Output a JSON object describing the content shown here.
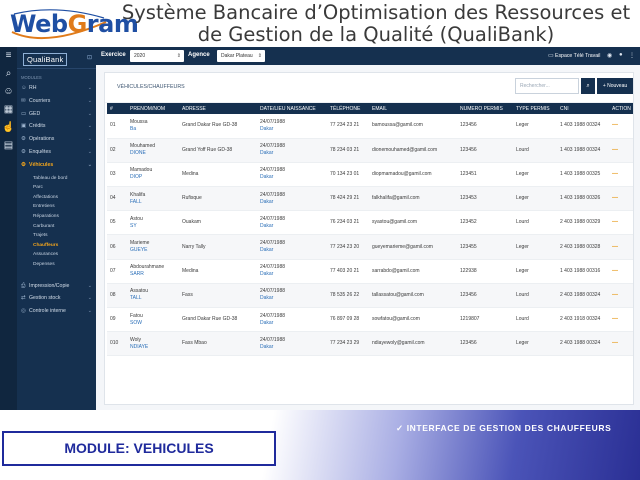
{
  "slide": {
    "title": "Système Bancaire d’Optimisation des Ressources et de Gestion de la Qualité (QualiBank)",
    "logo_text_a": "Web",
    "logo_text_b": "G",
    "logo_text_c": "ram",
    "module_label": "MODULE: VEHICULES",
    "interface_label": "INTERFACE DE GESTION DES CHAUFFEURS",
    "interface_check": "✓"
  },
  "topbar": {
    "exercice_label": "Exercice",
    "exercice_value": "2020",
    "agence_label": "Agence",
    "agence_value": "Dakar Plateau",
    "espace_label": "Espace Télé Travail"
  },
  "sidebar": {
    "logo": "QualiBank",
    "section": "MODULES",
    "items": [
      {
        "icon": "person-icon",
        "glyph": "☺",
        "label": "RH",
        "chevron": true
      },
      {
        "icon": "mail-icon",
        "glyph": "✉",
        "label": "Courriers",
        "chevron": true
      },
      {
        "icon": "folder-icon",
        "glyph": "▭",
        "label": "GED",
        "chevron": true
      },
      {
        "icon": "credit-icon",
        "glyph": "▣",
        "label": "Crédits",
        "chevron": true
      },
      {
        "icon": "gear-icon",
        "glyph": "⚙",
        "label": "Opérations",
        "chevron": true
      },
      {
        "icon": "gear-icon",
        "glyph": "⚙",
        "label": "Enquêtes",
        "chevron": true
      },
      {
        "icon": "car-icon",
        "glyph": "⚙",
        "label": "Véhicules",
        "chevron": true,
        "active": true
      }
    ],
    "subitems": [
      {
        "label": "Tableau de bord"
      },
      {
        "label": "Parc"
      },
      {
        "label": "Affectations"
      },
      {
        "label": "Entretiens"
      },
      {
        "label": "Réparations"
      },
      {
        "label": "Carburant"
      },
      {
        "label": "Trajets"
      },
      {
        "label": "Chauffeurs",
        "active": true
      },
      {
        "label": "Assurances"
      },
      {
        "label": "Depenses"
      }
    ],
    "bottom_items": [
      {
        "icon": "print-icon",
        "glyph": "⎙",
        "label": "Impression/Copie",
        "chevron": true
      },
      {
        "icon": "stock-icon",
        "glyph": "⇄",
        "label": "Gestion stock",
        "chevron": true
      },
      {
        "icon": "control-icon",
        "glyph": "◎",
        "label": "Controle interne",
        "chevron": true
      }
    ]
  },
  "card": {
    "title": "VÉHICULES/CHAUFFEURS",
    "search_placeholder": "Rechercher...",
    "new_button": "+ Nouveau",
    "search_glyph": "⌕"
  },
  "table": {
    "headers": [
      "#",
      "PRENOM/NOM",
      "ADRESSE",
      "DATE/LIEU NAISSANCE",
      "TÉLÉPHONE",
      "EMAIL",
      "NUMERO PERMIS",
      "TYPE PERMIS",
      "CNI",
      "ACTION"
    ],
    "rows": [
      {
        "num": "01",
        "prenom": "Moussa",
        "nom": "Ba",
        "adresse": "Grand Dakar Rue GD-38",
        "date": "24/07/1988",
        "lieu": "Dakar",
        "tel": "77 234 23 21",
        "email": "bamoussa@gamil.com",
        "permis": "123456",
        "type": "Leger",
        "cni": "1 403 1988 00324",
        "action": "—"
      },
      {
        "num": "02",
        "prenom": "Mouhamed",
        "nom": "DIONE",
        "adresse": "Grand Yoff Rue GD-38",
        "date": "24/07/1988",
        "lieu": "Dakar",
        "tel": "78 234 03 21",
        "email": "dionemouhamed@gamil.com",
        "permis": "123456",
        "type": "Lourd",
        "cni": "1 403 1988 00324",
        "action": "—"
      },
      {
        "num": "03",
        "prenom": "Mamadou",
        "nom": "DIOP",
        "adresse": "Medina",
        "date": "24/07/1988",
        "lieu": "Dakar",
        "tel": "70 134 23 01",
        "email": "diopmamadou@gamil.com",
        "permis": "123451",
        "type": "Leger",
        "cni": "1 403 1988 00325",
        "action": "—"
      },
      {
        "num": "04",
        "prenom": "Khalifa",
        "nom": "FALL",
        "adresse": "Rufisque",
        "date": "24/07/1988",
        "lieu": "Dakar",
        "tel": "78 424 29 21",
        "email": "falkhalifa@gamil.com",
        "permis": "123453",
        "type": "Leger",
        "cni": "1 403 1988 00326",
        "action": "—"
      },
      {
        "num": "05",
        "prenom": "Astou",
        "nom": "SY",
        "adresse": "Ouakam",
        "date": "24/07/1988",
        "lieu": "Dakar",
        "tel": "76 234 03 21",
        "email": "syastou@gamil.com",
        "permis": "123452",
        "type": "Lourd",
        "cni": "2 403 1988 00329",
        "action": "—"
      },
      {
        "num": "06",
        "prenom": "Marieme",
        "nom": "GUEYE",
        "adresse": "Narry Tally",
        "date": "24/07/1988",
        "lieu": "Dakar",
        "tel": "77 234 23 20",
        "email": "gueyemarieme@gamil.com",
        "permis": "123455",
        "type": "Leger",
        "cni": "2 403 1988 00328",
        "action": "—"
      },
      {
        "num": "07",
        "prenom": "Abdourahmane",
        "nom": "SARR",
        "adresse": "Medina",
        "date": "24/07/1988",
        "lieu": "Dakar",
        "tel": "77 403 20 21",
        "email": "sarrabdo@gamil.com",
        "permis": "122938",
        "type": "Leger",
        "cni": "1 403 1988 00316",
        "action": "—"
      },
      {
        "num": "08",
        "prenom": "Assatou",
        "nom": "TALL",
        "adresse": "Fass",
        "date": "24/07/1988",
        "lieu": "Dakar",
        "tel": "78 535 26 22",
        "email": "tallassatou@gamil.com",
        "permis": "123456",
        "type": "Lourd",
        "cni": "2 403 1988 00324",
        "action": "—"
      },
      {
        "num": "09",
        "prenom": "Fatou",
        "nom": "SOW",
        "adresse": "Grand Dakar Rue GD-38",
        "date": "24/07/1988",
        "lieu": "Dakar",
        "tel": "76 897 09 28",
        "email": "sowfatou@gamil.com",
        "permis": "1219807",
        "type": "Lourd",
        "cni": "2 403 1918 00324",
        "action": "—"
      },
      {
        "num": "010",
        "prenom": "Woly",
        "nom": "NDIAYE",
        "adresse": "Fass Mbao",
        "date": "24/07/1988",
        "lieu": "Dakar",
        "tel": "77 234 23 29",
        "email": "ndiayewoly@gamil.com",
        "permis": "123456",
        "type": "Leger",
        "cni": "2 403 1988 00324",
        "action": "—"
      }
    ]
  },
  "colors": {
    "navy": "#15304f",
    "accent": "#f3a51c",
    "link_blue": "#2b6fb8",
    "module_blue": "#1f2a9c"
  }
}
